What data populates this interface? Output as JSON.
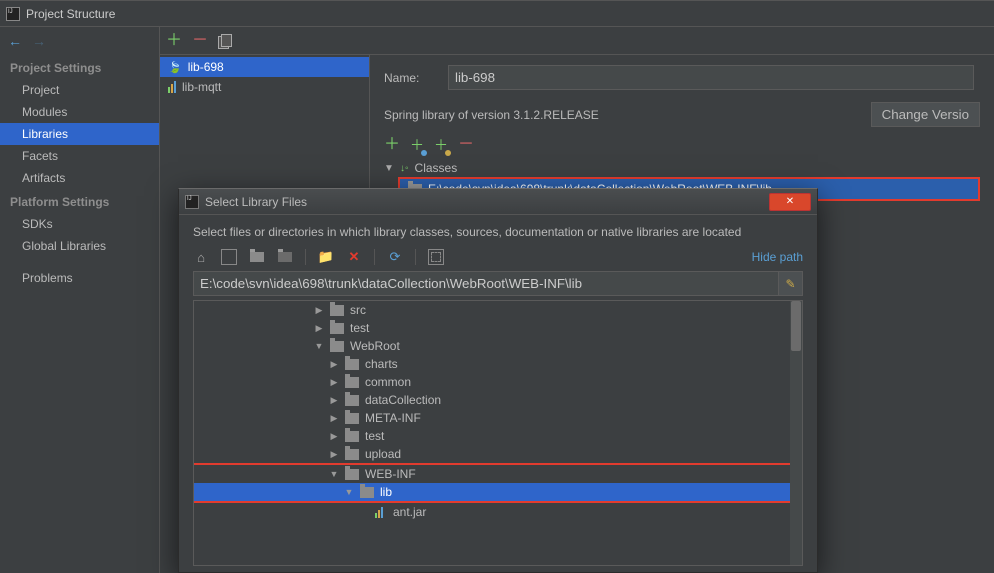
{
  "window": {
    "title": "Project Structure"
  },
  "sidebar": {
    "sections": [
      {
        "header": "Project Settings",
        "items": [
          "Project",
          "Modules",
          "Libraries",
          "Facets",
          "Artifacts"
        ],
        "selected": "Libraries"
      },
      {
        "header": "Platform Settings",
        "items": [
          "SDKs",
          "Global Libraries"
        ]
      },
      {
        "header": "",
        "items": [
          "Problems"
        ]
      }
    ]
  },
  "libraries": {
    "items": [
      {
        "name": "lib-698",
        "icon": "leaf",
        "selected": true
      },
      {
        "name": "lib-mqtt",
        "icon": "bars",
        "selected": false
      }
    ]
  },
  "detail": {
    "name_label": "Name:",
    "name_value": "lib-698",
    "spring_text": "Spring library of version 3.1.2.RELEASE",
    "change_btn": "Change Versio",
    "classes_header": "Classes",
    "class_path": "E:\\code\\svn\\idea\\698\\trunk\\dataCollection\\WebRoot\\WEB-INF\\lib"
  },
  "modal": {
    "title": "Select Library Files",
    "instruction": "Select files or directories in which library classes, sources, documentation or native libraries are located",
    "hide_path": "Hide path",
    "path_value": "E:\\code\\svn\\idea\\698\\trunk\\dataCollection\\WebRoot\\WEB-INF\\lib",
    "tree": [
      {
        "depth": 1,
        "arrow": "right",
        "label": "src"
      },
      {
        "depth": 1,
        "arrow": "right",
        "label": "test"
      },
      {
        "depth": 1,
        "arrow": "down",
        "label": "WebRoot"
      },
      {
        "depth": 2,
        "arrow": "right",
        "label": "charts"
      },
      {
        "depth": 2,
        "arrow": "right",
        "label": "common"
      },
      {
        "depth": 2,
        "arrow": "right",
        "label": "dataCollection"
      },
      {
        "depth": 2,
        "arrow": "right",
        "label": "META-INF"
      },
      {
        "depth": 2,
        "arrow": "right",
        "label": "test"
      },
      {
        "depth": 2,
        "arrow": "right",
        "label": "upload"
      },
      {
        "depth": 2,
        "arrow": "down",
        "label": "WEB-INF",
        "boxed": true
      },
      {
        "depth": 3,
        "arrow": "down",
        "label": "lib",
        "selected": true,
        "boxed": true
      },
      {
        "depth": 4,
        "arrow": "",
        "label": "ant.jar",
        "jar": true
      }
    ]
  }
}
